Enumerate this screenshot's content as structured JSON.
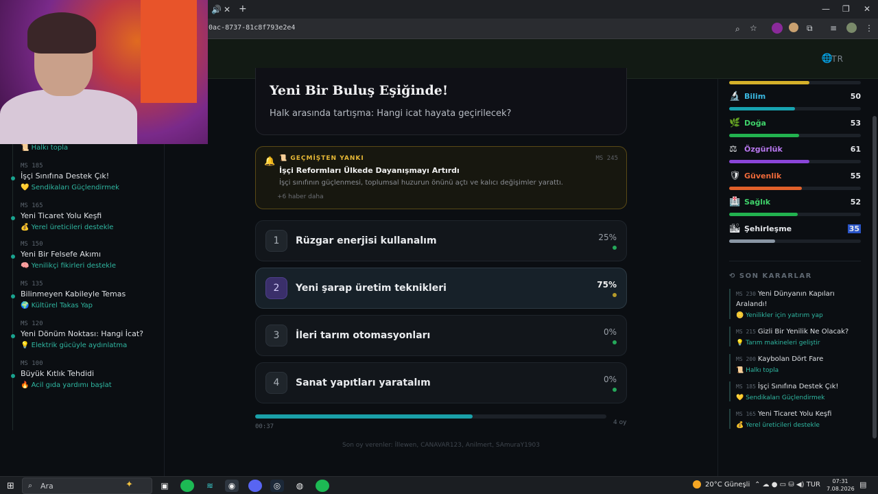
{
  "browser": {
    "url": "0ac-8737-81c8f793e2e4",
    "tab_glyphs": {
      "audio": "🔊",
      "close": "✕",
      "new_tab": "+"
    }
  },
  "page": {
    "lang": "TR",
    "event": {
      "title": "Yeni Bir Buluş Eşiğinde!",
      "description": "Halk arasında tartışma: Hangi icat hayata geçirilecek?"
    },
    "echo": {
      "label": "GEÇMİŞTEN YANKI",
      "ms": "MS 245",
      "title": "İşçi Reformları Ülkede Dayanışmayı Artırdı",
      "description": "İşçi sınıfının güçlenmesi, toplumsal huzurun önünü açtı ve kalıcı değişimler yarattı.",
      "more": "+6 haber daha"
    },
    "options": [
      {
        "num": "1",
        "label": "Rüzgar enerjisi kullanalım",
        "pct": "25%"
      },
      {
        "num": "2",
        "label": "Yeni şarap üretim teknikleri",
        "pct": "75%"
      },
      {
        "num": "3",
        "label": "İleri tarım otomasyonları",
        "pct": "0%"
      },
      {
        "num": "4",
        "label": "Sanat yapıtları yaratalım",
        "pct": "0%"
      }
    ],
    "timer": {
      "text": "00:37",
      "progress": 0.62
    },
    "vote_count": "4 oy",
    "recent_voters": "Son oy verenler: İllewen, CANAVAR123, Anilmert, SAmuraY1903",
    "timeline": [
      {
        "ms": "",
        "title": "",
        "sub": "📜 Halkı topla"
      },
      {
        "ms": "MS 185",
        "title": "İşçi Sınıfına Destek Çık!",
        "sub": "💛 Sendikaları Güçlendirmek"
      },
      {
        "ms": "MS 165",
        "title": "Yeni Ticaret Yolu Keşfi",
        "sub": "💰 Yerel üreticileri destekle"
      },
      {
        "ms": "MS 150",
        "title": "Yeni Bir Felsefe Akımı",
        "sub": "🧠 Yenilikçi fikirleri destekle"
      },
      {
        "ms": "MS 135",
        "title": "Bilinmeyen Kabileyle Temas",
        "sub": "🌍 Kültürel Takas Yap"
      },
      {
        "ms": "MS 120",
        "title": "Yeni Dönüm Noktası: Hangi İcat?",
        "sub": "💡 Elektrik gücüyle aydınlatma"
      },
      {
        "ms": "MS 100",
        "title": "Büyük Kıtlık Tehdidi",
        "sub": "🔥 Acil gıda yardımı başlat"
      }
    ],
    "stats": [
      {
        "icon": "🔬",
        "name": "Bilim",
        "value": "50",
        "level": 0.5,
        "color": "#3ab8e0",
        "bar": "#17a3b0"
      },
      {
        "icon": "🌿",
        "name": "Doğa",
        "value": "53",
        "level": 0.53,
        "color": "#3fd26a",
        "bar": "#22b24f"
      },
      {
        "icon": "⚖",
        "name": "Özgürlük",
        "value": "61",
        "level": 0.61,
        "color": "#b978f0",
        "bar": "#8a45d8"
      },
      {
        "icon": "🛡",
        "name": "Güvenlik",
        "value": "55",
        "level": 0.55,
        "color": "#f06a3a",
        "bar": "#e0602a"
      },
      {
        "icon": "🏥",
        "name": "Sağlık",
        "value": "52",
        "level": 0.52,
        "color": "#3fd26a",
        "bar": "#22b24f"
      },
      {
        "icon": "🏙",
        "name": "Şehirleşme",
        "value": "35",
        "level": 0.35,
        "color": "#e4e6ea",
        "bar": "#8a96a4"
      }
    ],
    "top_stat_level": 0.61,
    "top_stat_color": "#d4b02a",
    "decisions_title": "SON KARARLAR",
    "decisions": [
      {
        "ms": "MS 230",
        "title": "Yeni Dünyanın Kapıları Aralandı!",
        "sub": "🪙 Yenilikler için yatırım yap"
      },
      {
        "ms": "MS 215",
        "title": "Gizli Bir Yenilik Ne Olacak?",
        "sub": "💡 Tarım makineleri geliştir"
      },
      {
        "ms": "MS 200",
        "title": "Kaybolan Dört Fare",
        "sub": "📜 Halkı topla"
      },
      {
        "ms": "MS 185",
        "title": "İşçi Sınıfına Destek Çık!",
        "sub": "💛 Sendikaları Güçlendirmek"
      },
      {
        "ms": "MS 165",
        "title": "Yeni Ticaret Yolu Keşfi",
        "sub": "💰 Yerel üreticileri destekle"
      }
    ]
  },
  "taskbar": {
    "search_placeholder": "Ara",
    "weather": "20°C  Güneşli",
    "lang": "TUR",
    "time": "07:31",
    "date": "7.08.2026"
  }
}
